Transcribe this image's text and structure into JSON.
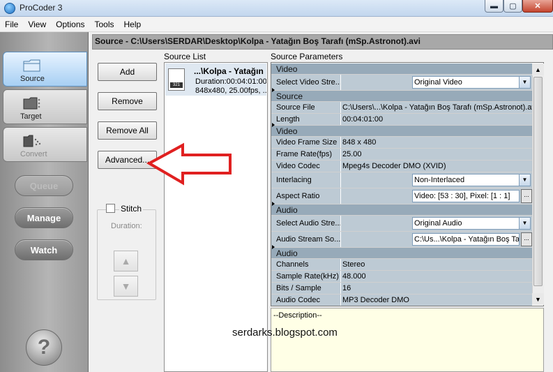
{
  "window": {
    "title": "ProCoder 3",
    "controls": {
      "minimize": "▬",
      "maximize": "▢",
      "close": "✕"
    }
  },
  "menu": [
    "File",
    "View",
    "Options",
    "Tools",
    "Help"
  ],
  "nav": {
    "tabs": [
      {
        "label": "Source",
        "state": "active"
      },
      {
        "label": "Target",
        "state": "normal"
      },
      {
        "label": "Convert",
        "state": "disabled"
      }
    ],
    "buttons": {
      "queue": "Queue",
      "manage": "Manage",
      "watch": "Watch"
    },
    "help": "?"
  },
  "header": "Source - C:\\Users\\SERDAR\\Desktop\\Kolpa - Yatağın Boş Tarafı (mSp.Astronot).avi",
  "actions": {
    "add": "Add",
    "remove": "Remove",
    "remove_all": "Remove All",
    "advanced": "Advanced..."
  },
  "stitch": {
    "label": "Stitch",
    "duration": "Duration:",
    "checked": false,
    "up": "▲",
    "down": "▼"
  },
  "source_list": {
    "label": "Source List",
    "items": [
      {
        "icon_badge": "321",
        "name": "...\\Kolpa - Yatağın",
        "duration": "Duration:00:04:01:00",
        "info": "848x480, 25.00fps, ..."
      }
    ]
  },
  "source_parameters": {
    "label": "Source Parameters",
    "rows": [
      {
        "type": "section",
        "label": "Video"
      },
      {
        "type": "combo",
        "label": "Select Video Stre...",
        "value": "Original Video"
      },
      {
        "type": "section",
        "label": "Source"
      },
      {
        "type": "field",
        "label": "Source File",
        "value": "C:\\Users\\...\\Kolpa - Yatağın Boş Tarafı (mSp.Astronot).avi"
      },
      {
        "type": "field",
        "label": "Length",
        "value": "00:04:01:00"
      },
      {
        "type": "section",
        "label": "Video"
      },
      {
        "type": "field",
        "label": "Video Frame Size",
        "value": "848 x 480"
      },
      {
        "type": "field",
        "label": "Frame Rate(fps)",
        "value": "25.00"
      },
      {
        "type": "field",
        "label": "Video Codec",
        "value": "Mpeg4s Decoder DMO  (XVID)"
      },
      {
        "type": "combo",
        "label": "Interlacing",
        "value": "Non-Interlaced"
      },
      {
        "type": "ellipsis",
        "label": "Aspect Ratio",
        "value": "Video: [53 : 30], Pixel: [1 : 1]"
      },
      {
        "type": "section",
        "label": "Audio"
      },
      {
        "type": "combo",
        "label": "Select Audio Stre...",
        "value": "Original Audio"
      },
      {
        "type": "ellipsis",
        "label": "Audio Stream So...",
        "value": "C:\\Us...\\Kolpa - Yatağın Boş Tarafı (mSp.Astronot).avi"
      },
      {
        "type": "section",
        "label": "Audio"
      },
      {
        "type": "field",
        "label": "Channels",
        "value": "Stereo"
      },
      {
        "type": "field",
        "label": "Sample Rate(kHz)",
        "value": "48.000"
      },
      {
        "type": "field",
        "label": "Bits / Sample",
        "value": "16"
      },
      {
        "type": "field",
        "label": "Audio Codec",
        "value": "MP3 Decoder DMO"
      }
    ]
  },
  "description": "--Description--",
  "watermark": "serdarks.blogspot.com",
  "annotation": {
    "arrow_color": "#e02020",
    "points_to": "advanced-button"
  },
  "colors": {
    "section_bg": "#97aab9",
    "row_bg": "#bdcad4",
    "header_bg": "#a8a8a8",
    "active_tab": "#a7cff3"
  }
}
